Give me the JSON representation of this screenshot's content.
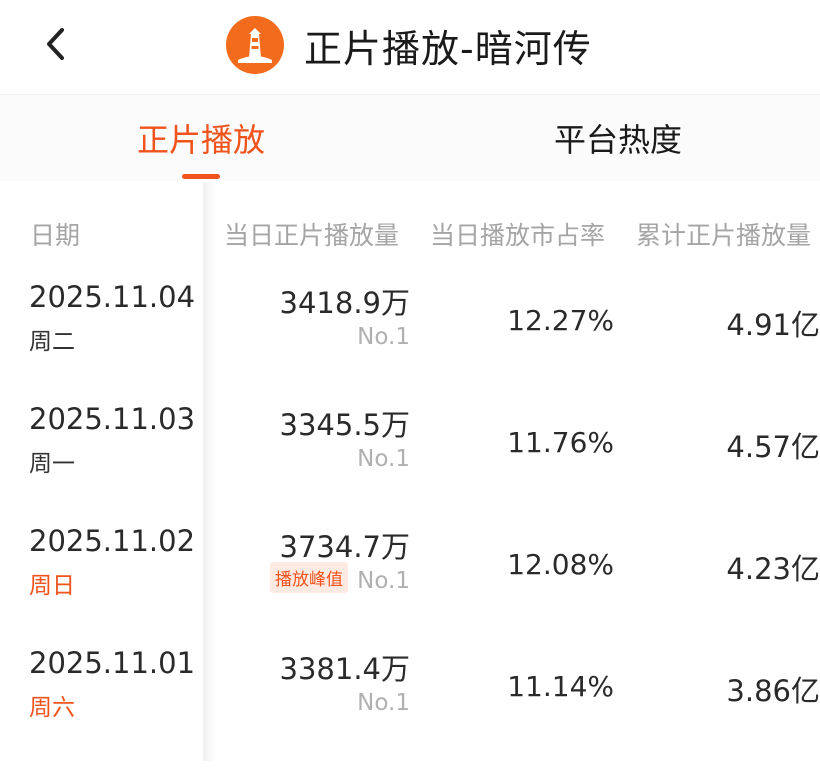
{
  "header": {
    "title": "正片播放-暗河传",
    "back_icon": "chevron-left-icon",
    "logo_icon": "lighthouse-logo-icon"
  },
  "tabs": [
    {
      "label": "正片播放",
      "active": true
    },
    {
      "label": "平台热度",
      "active": false
    }
  ],
  "table": {
    "columns": [
      "日期",
      "当日正片播放量",
      "当日播放市占率",
      "累计正片播放量"
    ],
    "rows": [
      {
        "date": "2025.11.04",
        "weekday": "周二",
        "weekend": false,
        "plays": "3418.9万",
        "rank": "No.1",
        "badge": "",
        "share": "12.27%",
        "total": "4.91亿"
      },
      {
        "date": "2025.11.03",
        "weekday": "周一",
        "weekend": false,
        "plays": "3345.5万",
        "rank": "No.1",
        "badge": "",
        "share": "11.76%",
        "total": "4.57亿"
      },
      {
        "date": "2025.11.02",
        "weekday": "周日",
        "weekend": true,
        "plays": "3734.7万",
        "rank": "No.1",
        "badge": "播放峰值",
        "share": "12.08%",
        "total": "4.23亿"
      },
      {
        "date": "2025.11.01",
        "weekday": "周六",
        "weekend": true,
        "plays": "3381.4万",
        "rank": "No.1",
        "badge": "",
        "share": "11.14%",
        "total": "3.86亿"
      }
    ]
  },
  "colors": {
    "accent": "#f0531c",
    "logo": "#f36b1c",
    "header_text": "#a5a5a5",
    "rank_text": "#b0b0b0"
  }
}
